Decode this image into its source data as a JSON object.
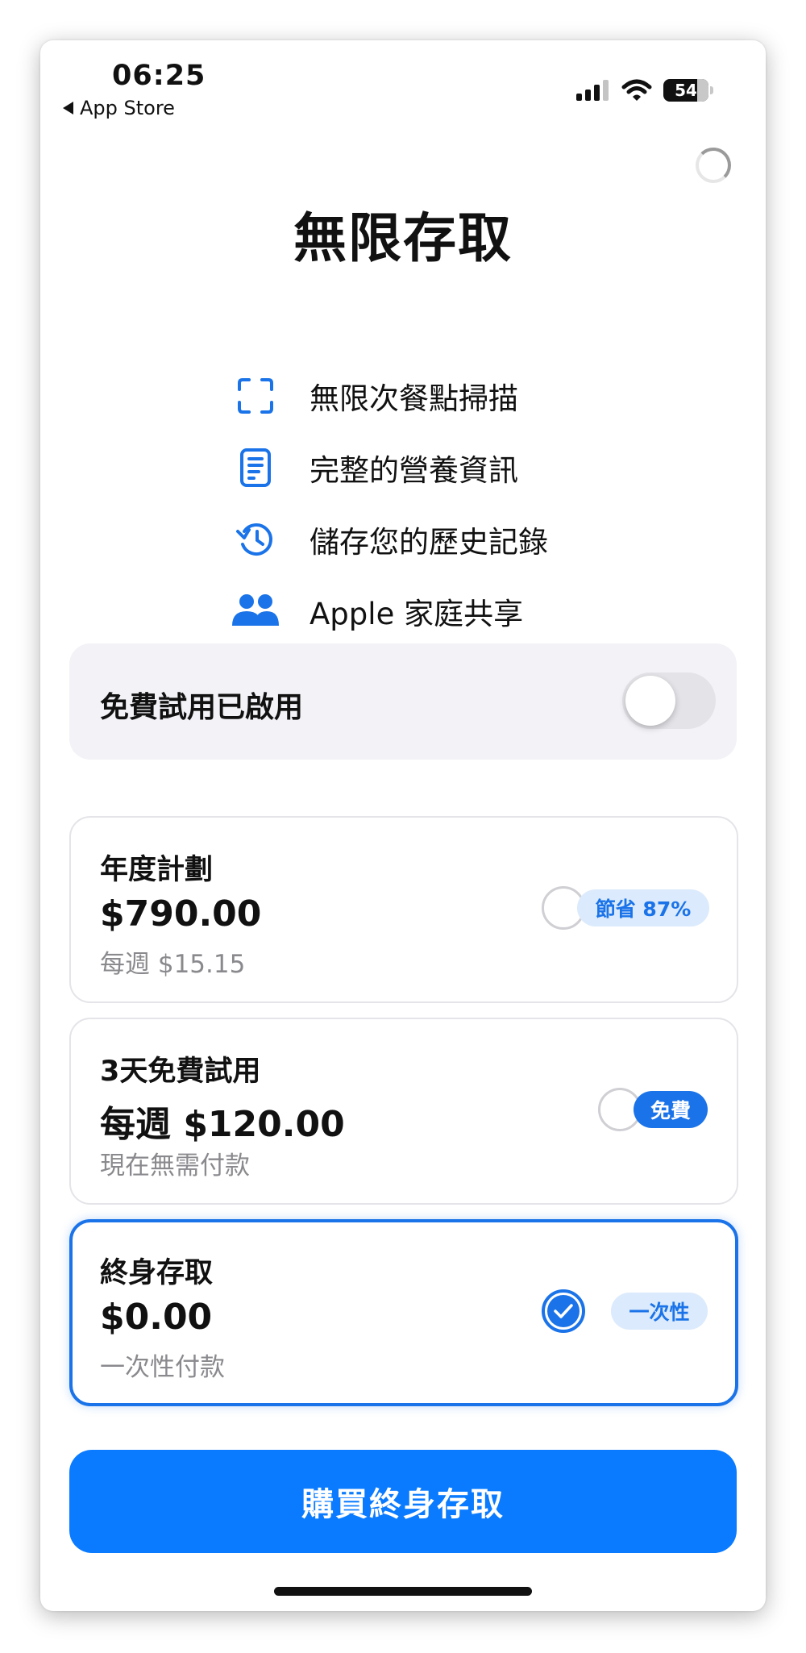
{
  "status_bar": {
    "time": "06:25",
    "back_label": "App Store",
    "battery": "54"
  },
  "title": "無限存取",
  "features": [
    {
      "icon": "scan-icon",
      "label": "無限次餐點掃描"
    },
    {
      "icon": "document-icon",
      "label": "完整的營養資訊"
    },
    {
      "icon": "history-icon",
      "label": "儲存您的歷史記錄"
    },
    {
      "icon": "family-icon",
      "label": "Apple 家庭共享"
    }
  ],
  "free_trial_toggle": {
    "label": "免費試用已啟用",
    "enabled": false
  },
  "plans": [
    {
      "name": "年度計劃",
      "price": "$790.00",
      "sub": "每週 $15.15",
      "badge": "節省 87%",
      "selected": false
    },
    {
      "name": "3天免費試用",
      "price": "每週 $120.00",
      "sub": "現在無需付款",
      "badge": "免費",
      "selected": false
    },
    {
      "name": "終身存取",
      "price": "$0.00",
      "sub": "一次性付款",
      "badge": "一次性",
      "selected": true
    }
  ],
  "purchase_button": "購買終身存取",
  "colors": {
    "accent": "#1a73e8",
    "button": "#0a7bff",
    "badge_light": "#dbeafc",
    "card_border": "#e4e4e9",
    "trial_bg": "#f2f2f7"
  }
}
